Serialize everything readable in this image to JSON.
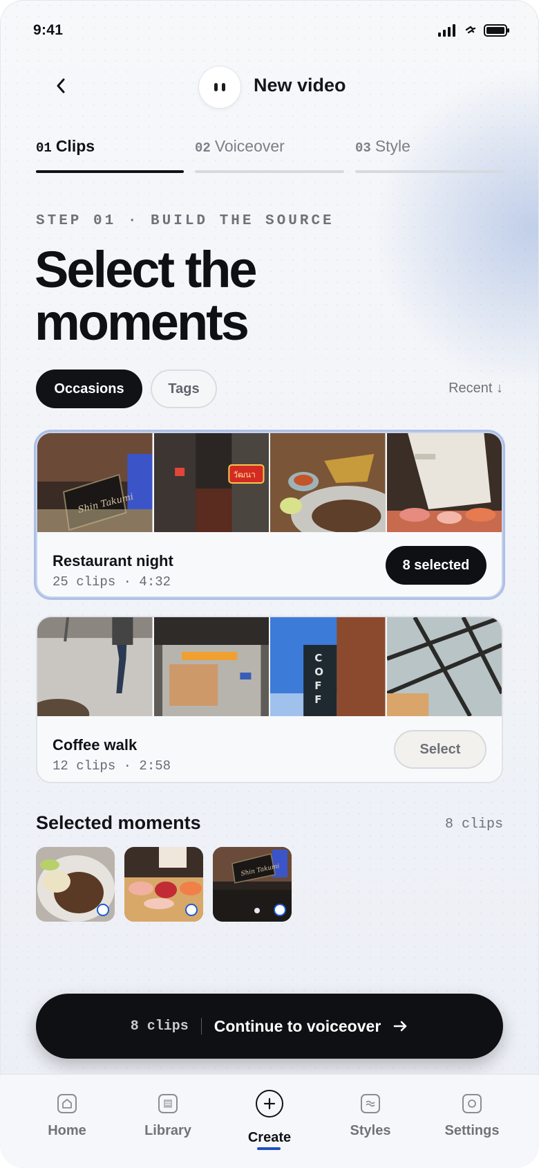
{
  "status_bar": {
    "time": "9:41"
  },
  "header": {
    "title": "New video"
  },
  "tabs": [
    {
      "num": "01",
      "label": "Clips",
      "active": true
    },
    {
      "num": "02",
      "label": "Voiceover",
      "active": false
    },
    {
      "num": "03",
      "label": "Style",
      "active": false
    }
  ],
  "eyebrow": "STEP 01 · BUILD THE SOURCE",
  "headline": {
    "line1": "Select the",
    "line2": "moments"
  },
  "filters": {
    "occasions": "Occasions",
    "tags": "Tags",
    "sort": "Recent ↓"
  },
  "occasions": [
    {
      "title": "Restaurant night",
      "meta": "25 clips · 4:32",
      "action": "8 selected",
      "selected": true,
      "thumbs": [
        "sign-shin-takumi",
        "storefront-night",
        "thai-plates",
        "chef-sushi"
      ]
    },
    {
      "title": "Coffee walk",
      "meta": "12 clips · 2:58",
      "action": "Select",
      "selected": false,
      "thumbs": [
        "sidewalk-walk",
        "subway-train",
        "coffee-sign",
        "glass-roof"
      ]
    }
  ],
  "selected_moments": {
    "title": "Selected moments",
    "count": "8 clips",
    "items": [
      "beef-noodle-plate",
      "sashimi-board",
      "shin-takumi-sign"
    ]
  },
  "cta": {
    "count": "8 clips",
    "label": "Continue to voiceover"
  },
  "nav": [
    {
      "label": "Home",
      "icon": "home-icon"
    },
    {
      "label": "Library",
      "icon": "library-icon"
    },
    {
      "label": "Create",
      "icon": "create-icon",
      "active": true
    },
    {
      "label": "Styles",
      "icon": "styles-icon"
    },
    {
      "label": "Settings",
      "icon": "settings-icon"
    }
  ],
  "colors": {
    "accent": "#1d4fc4",
    "primary": "#0f1014",
    "selected_ring": "#aebfe6"
  }
}
